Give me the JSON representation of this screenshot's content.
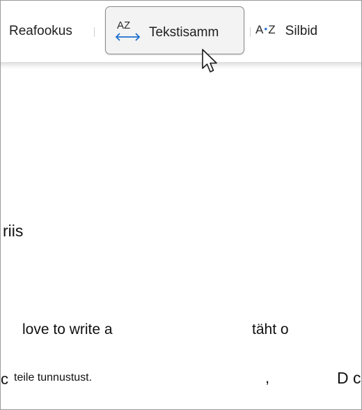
{
  "toolbar": {
    "focus_label": "Reafookus",
    "spacing_label": "Tekstisamm",
    "spacing_icon_text": "AZ",
    "syllables_label": "Silbid",
    "syllables_icon_left": "A",
    "syllables_icon_dot": "•",
    "syllables_icon_right": "Z"
  },
  "content": {
    "fragment_1": "riis",
    "fragment_2": "love to write a",
    "fragment_3": "täht o",
    "fragment_4": "c",
    "fragment_5": "teile tunnustust.",
    "fragment_6": ",",
    "fragment_7": "D c"
  },
  "colors": {
    "accent_icon": "#1f6fcf",
    "selected_bg": "#f3f3f3",
    "selected_border": "#8a8a8a",
    "text": "#111111"
  }
}
